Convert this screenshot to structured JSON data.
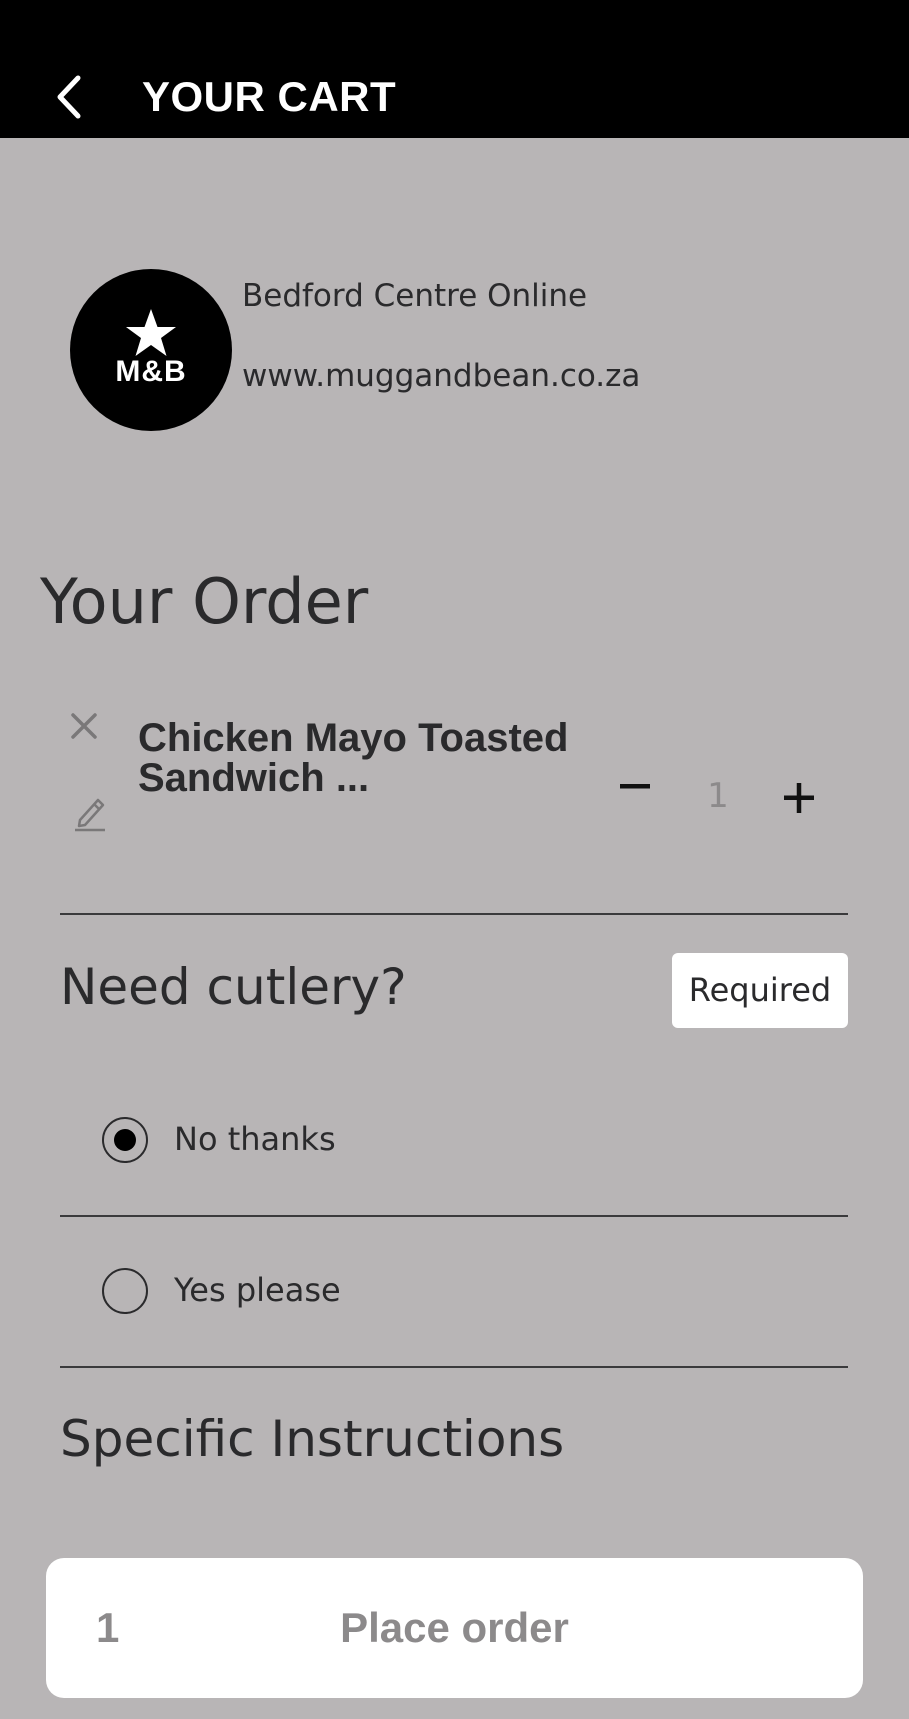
{
  "header": {
    "title": "YOUR CART",
    "back_icon": "chevron-left-icon"
  },
  "store": {
    "logo_text": "M&B",
    "logo_icon": "star-icon",
    "name": "Bedford Centre Online",
    "url": "www.muggandbean.co.za"
  },
  "order": {
    "heading": "Your Order",
    "items": [
      {
        "name": "Chicken Mayo Toasted Sandwich ...",
        "quantity": "1",
        "remove_icon": "close-icon",
        "edit_icon": "pencil-icon",
        "minus_icon": "minus-icon",
        "plus_icon": "plus-icon"
      }
    ]
  },
  "cutlery": {
    "question": "Need cutlery?",
    "badge": "Required",
    "options": [
      {
        "label": "No thanks",
        "selected": true
      },
      {
        "label": "Yes please",
        "selected": false
      }
    ]
  },
  "instructions": {
    "heading": "Specific Instructions"
  },
  "footer": {
    "count": "1",
    "button_label": "Place order"
  },
  "colors": {
    "background": "#b8b5b6",
    "header": "#000000",
    "text": "#2a2a2c",
    "muted": "#8c8a8b",
    "button_bg": "#ffffff"
  }
}
